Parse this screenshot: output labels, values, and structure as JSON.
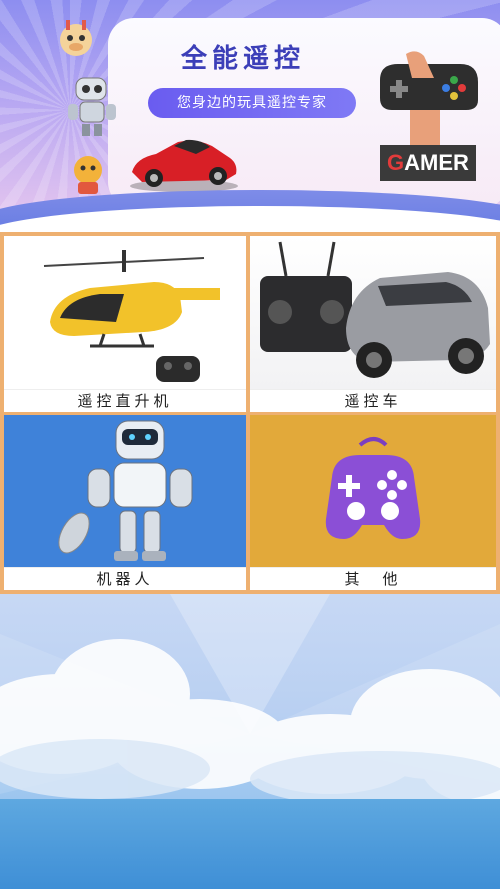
{
  "banner": {
    "title": "全能遥控",
    "subtitle": "您身边的玩具遥控专家",
    "gamer_badge_first": "G",
    "gamer_badge_rest": "AMER"
  },
  "categories": [
    {
      "label": "遥控直升机",
      "icon": "helicopter-image"
    },
    {
      "label": "遥控车",
      "icon": "rc-car-image"
    },
    {
      "label": "机器人",
      "icon": "robot-image"
    },
    {
      "label": "其　他",
      "icon": "gamepad-image"
    }
  ],
  "colors": {
    "accent": "#3c3fb8",
    "grid_border": "#eeb070",
    "robot_bg": "#3f82d9",
    "other_bg": "#e2a93a"
  }
}
